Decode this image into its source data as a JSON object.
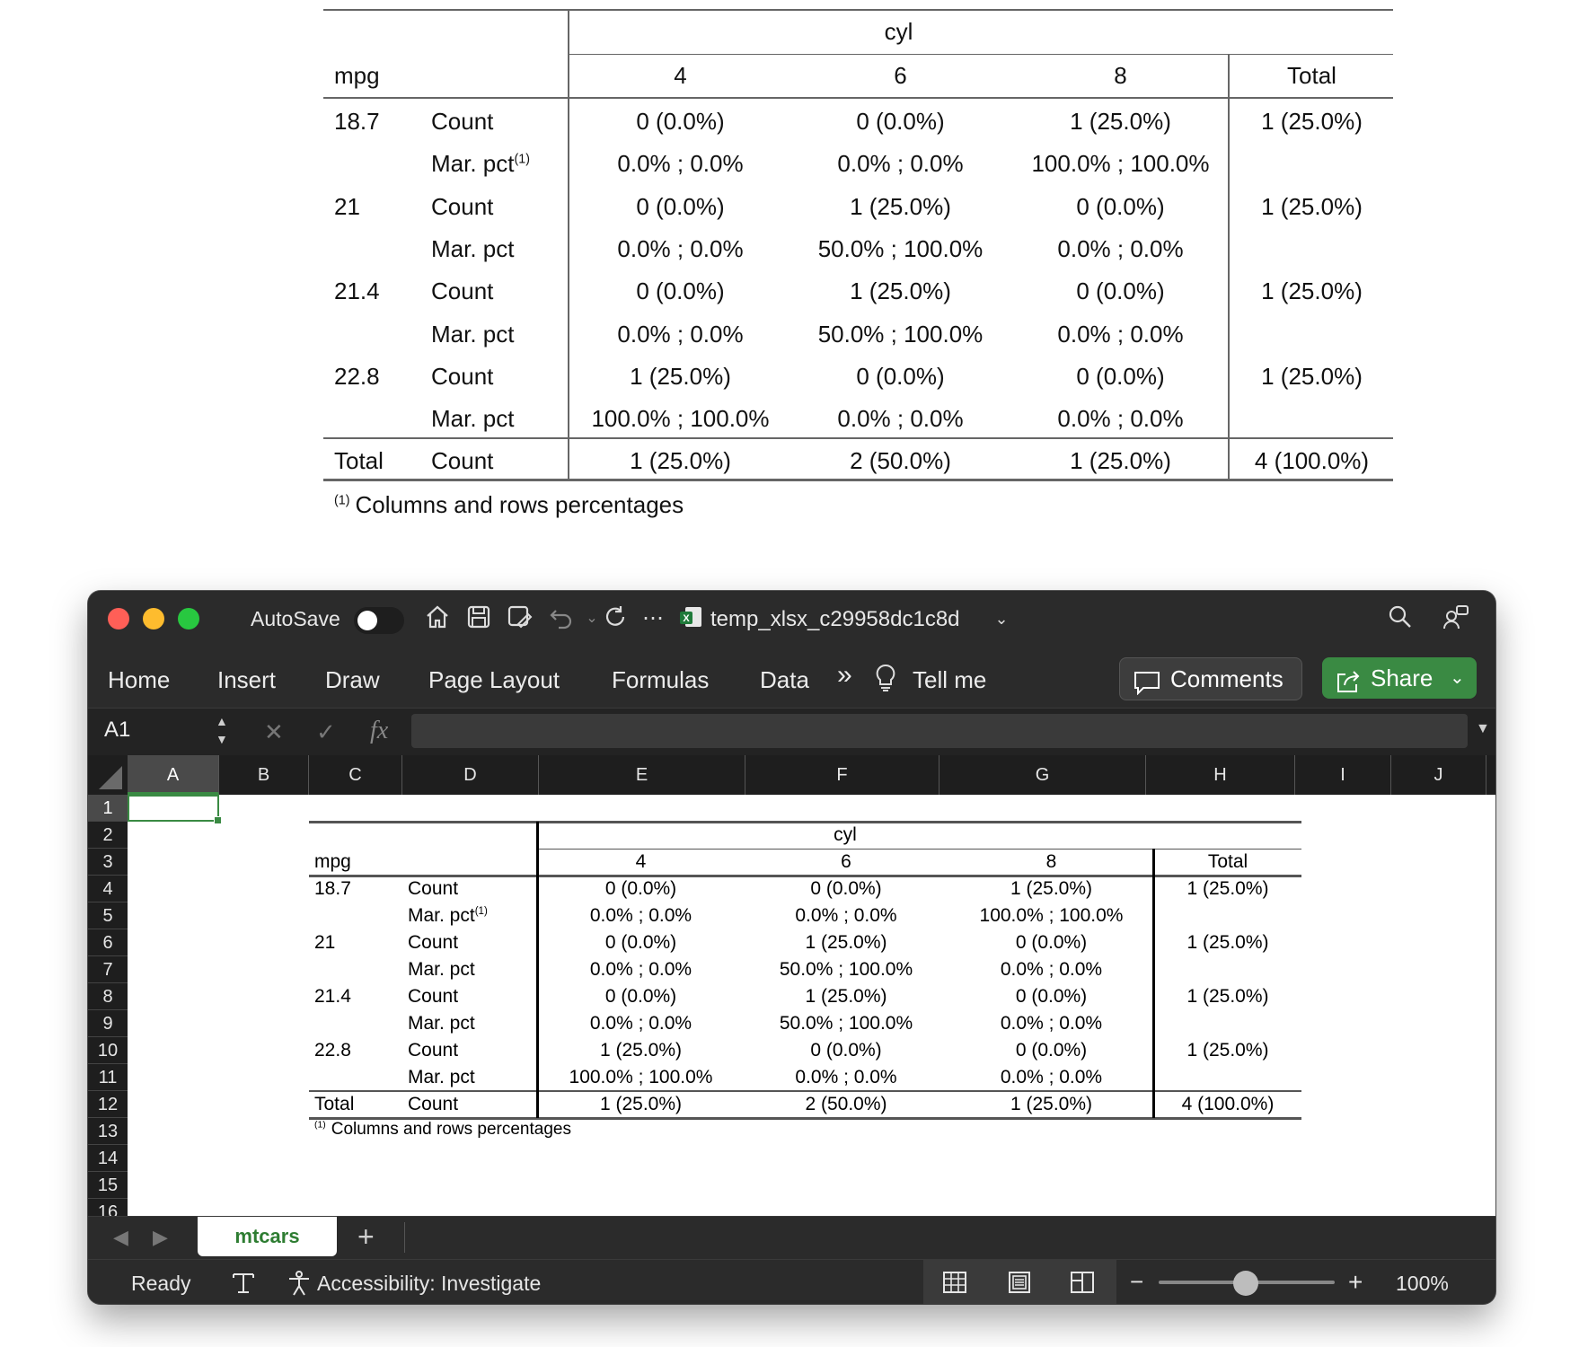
{
  "report": {
    "col_var": "cyl",
    "row_var": "mpg",
    "columns": [
      "4",
      "6",
      "8",
      "Total"
    ],
    "rows": [
      {
        "group": "18.7",
        "stat": "Count",
        "values": [
          "0 (0.0%)",
          "0 (0.0%)",
          "1 (25.0%)",
          "1 (25.0%)"
        ]
      },
      {
        "group": "",
        "stat": "Mar. pct",
        "footnote": "(1)",
        "values": [
          "0.0% ; 0.0%",
          "0.0% ; 0.0%",
          "100.0% ; 100.0%",
          ""
        ]
      },
      {
        "group": "21",
        "stat": "Count",
        "values": [
          "0 (0.0%)",
          "1 (25.0%)",
          "0 (0.0%)",
          "1 (25.0%)"
        ]
      },
      {
        "group": "",
        "stat": "Mar. pct",
        "values": [
          "0.0% ; 0.0%",
          "50.0% ; 100.0%",
          "0.0% ; 0.0%",
          ""
        ]
      },
      {
        "group": "21.4",
        "stat": "Count",
        "values": [
          "0 (0.0%)",
          "1 (25.0%)",
          "0 (0.0%)",
          "1 (25.0%)"
        ]
      },
      {
        "group": "",
        "stat": "Mar. pct",
        "values": [
          "0.0% ; 0.0%",
          "50.0% ; 100.0%",
          "0.0% ; 0.0%",
          ""
        ]
      },
      {
        "group": "22.8",
        "stat": "Count",
        "values": [
          "1 (25.0%)",
          "0 (0.0%)",
          "0 (0.0%)",
          "1 (25.0%)"
        ]
      },
      {
        "group": "",
        "stat": "Mar. pct",
        "values": [
          "100.0% ; 100.0%",
          "0.0% ; 0.0%",
          "0.0% ; 0.0%",
          ""
        ]
      },
      {
        "group": "Total",
        "stat": "Count",
        "values": [
          "1 (25.0%)",
          "2 (50.0%)",
          "1 (25.0%)",
          "4 (100.0%)"
        ]
      }
    ],
    "footnote_mark": "(1)",
    "footnote_text": "Columns and rows percentages"
  },
  "window": {
    "autosave_label": "AutoSave",
    "file_name": "temp_xlsx_c29958dc1c8d",
    "tabs": [
      "Home",
      "Insert",
      "Draw",
      "Page Layout",
      "Formulas",
      "Data"
    ],
    "more_tabs": "»",
    "tell_me": "Tell me",
    "comments_label": "Comments",
    "share_label": "Share",
    "name_box": "A1",
    "fx_label": "fx",
    "columns": [
      "A",
      "B",
      "C",
      "D",
      "E",
      "F",
      "G",
      "H",
      "I",
      "J"
    ],
    "row_numbers": [
      "1",
      "2",
      "3",
      "4",
      "5",
      "6",
      "7",
      "8",
      "9",
      "10",
      "11",
      "12",
      "13",
      "14",
      "15",
      "16"
    ],
    "sheet_tab": "mtcars",
    "status_ready": "Ready",
    "accessibility": "Accessibility: Investigate",
    "zoom": "100%",
    "zoom_minus": "−",
    "zoom_plus": "+"
  },
  "colors": {
    "accent": "#3a8a43",
    "close": "#ff5f57",
    "minimize": "#febc2e",
    "maximize": "#28c840"
  }
}
